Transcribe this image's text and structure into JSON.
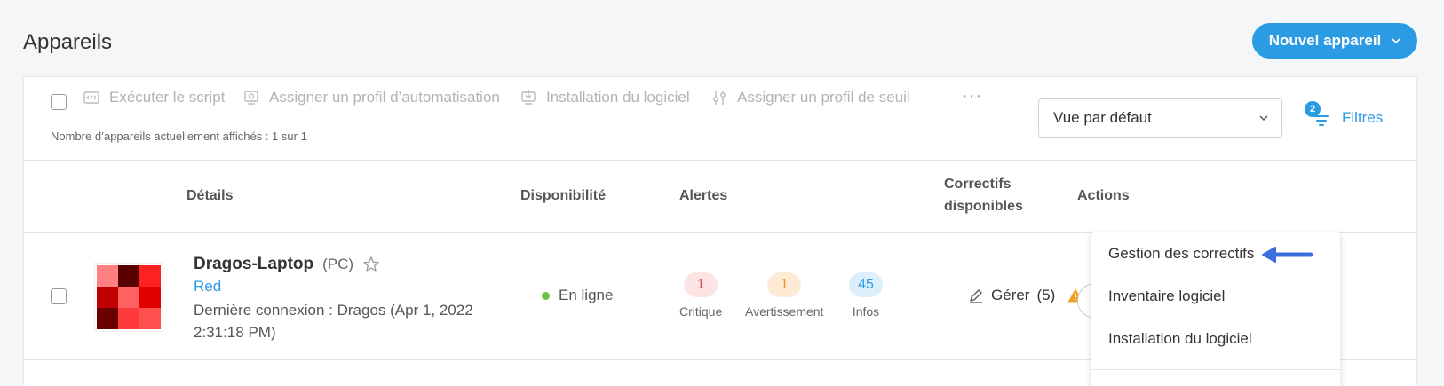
{
  "page": {
    "title": "Appareils"
  },
  "new_device": {
    "label": "Nouvel appareil"
  },
  "toolbar": {
    "run_script": "Exécuter le script",
    "assign_automation": "Assigner un profil d’automatisation",
    "install_software": "Installation du logiciel",
    "assign_threshold": "Assigner un profil de seuil",
    "more": "···",
    "count_text": "Nombre d’appareils actuellement affichés : 1 sur 1"
  },
  "view_select": {
    "selected": "Vue par défaut"
  },
  "filters": {
    "label": "Filtres",
    "badge": "2"
  },
  "columns": {
    "details": "Détails",
    "availability": "Disponibilité",
    "alerts": "Alertes",
    "patches_line1": "Correctifs",
    "patches_line2": "disponibles",
    "actions": "Actions"
  },
  "device": {
    "name": "Dragos-Laptop",
    "type": "(PC)",
    "group": "Red",
    "last_connection": "Dernière connexion : Dragos (Apr 1, 2022 2:31:18 PM)",
    "availability": "En ligne",
    "alerts": {
      "critical": {
        "count": "1",
        "label": "Critique"
      },
      "warning": {
        "count": "1",
        "label": "Avertissement"
      },
      "info": {
        "count": "45",
        "label": "Infos"
      }
    },
    "patches": {
      "label": "Gérer",
      "count": "(5)"
    },
    "avatar_colors": [
      "#ff8080",
      "#5a0000",
      "#ff2020",
      "#bf0000",
      "#ff6060",
      "#e00000",
      "#6a0000",
      "#ff3a3a",
      "#ff5050"
    ]
  },
  "actions_menu": {
    "items": [
      "Gestion des correctifs",
      "Inventaire logiciel",
      "Installation du logiciel"
    ]
  },
  "colors": {
    "accent": "#2b9be3",
    "online": "#6cc24a",
    "critical_bg": "#fde4e4",
    "critical_fg": "#e04848",
    "warning_bg": "#fdebd6",
    "warning_fg": "#f0901e",
    "info_bg": "#ddeefb",
    "info_fg": "#2b9be3"
  }
}
